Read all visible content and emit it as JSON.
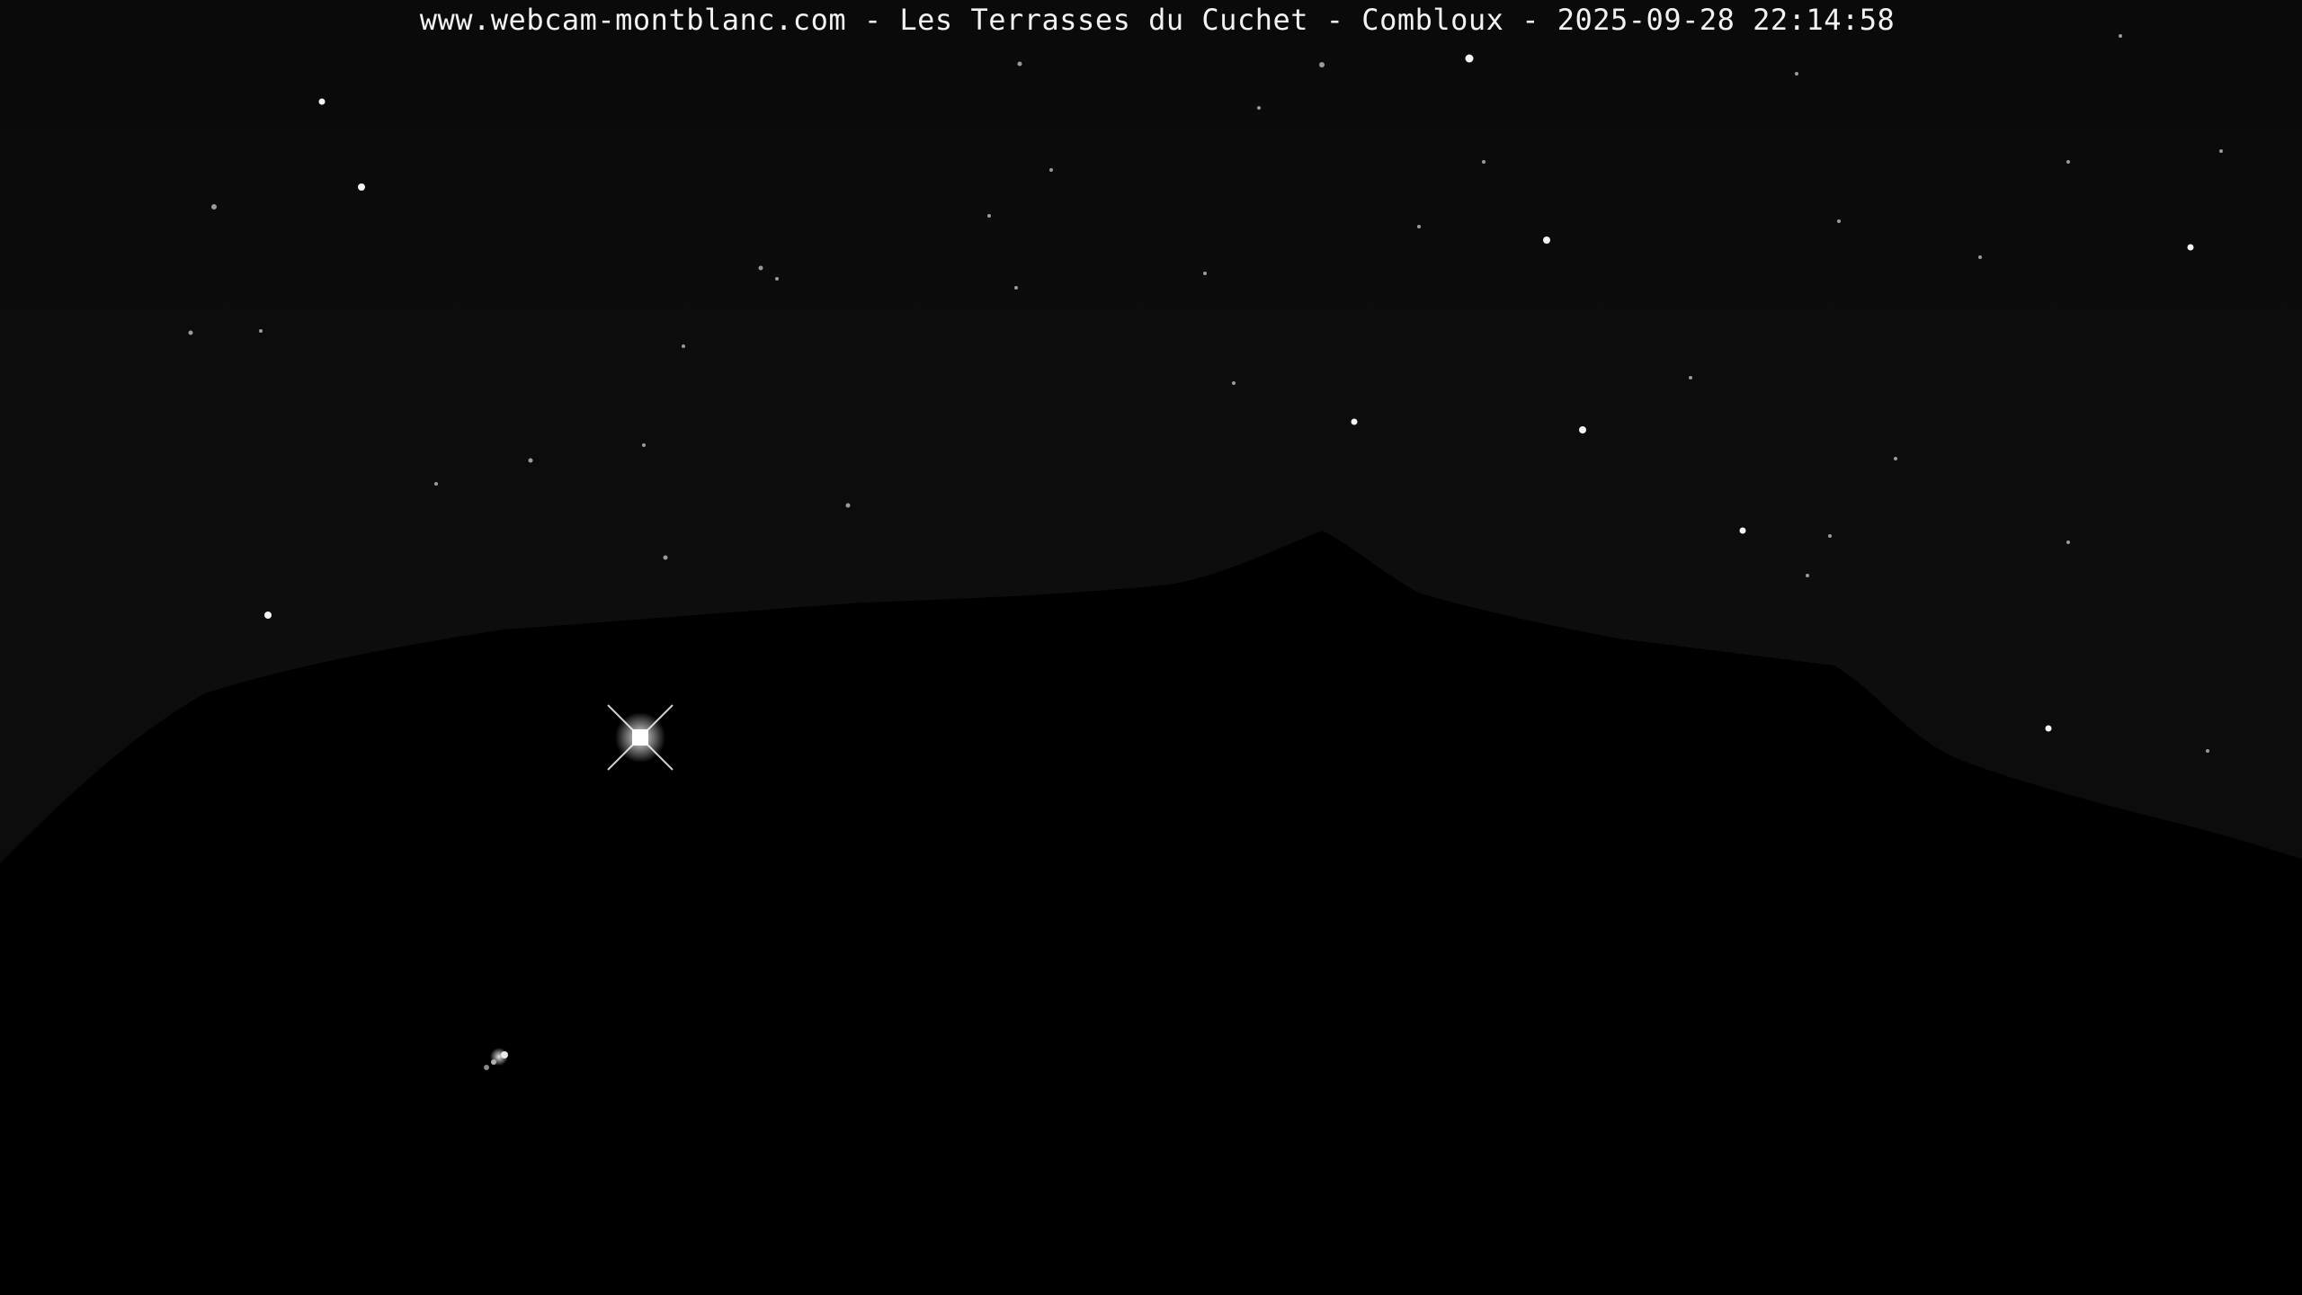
{
  "webcam": {
    "caption": "www.webcam-montblanc.com - Les Terrasses du Cuchet - Combloux - 2025-09-28 22:14:58",
    "scene": "night",
    "colors": {
      "sky": "#0b0b0b",
      "mountain": "#000000",
      "stars": "#ffffff",
      "caption_text": "#f2f2f2"
    },
    "icons": [
      "bright-star",
      "faint-star",
      "ground-light"
    ]
  }
}
